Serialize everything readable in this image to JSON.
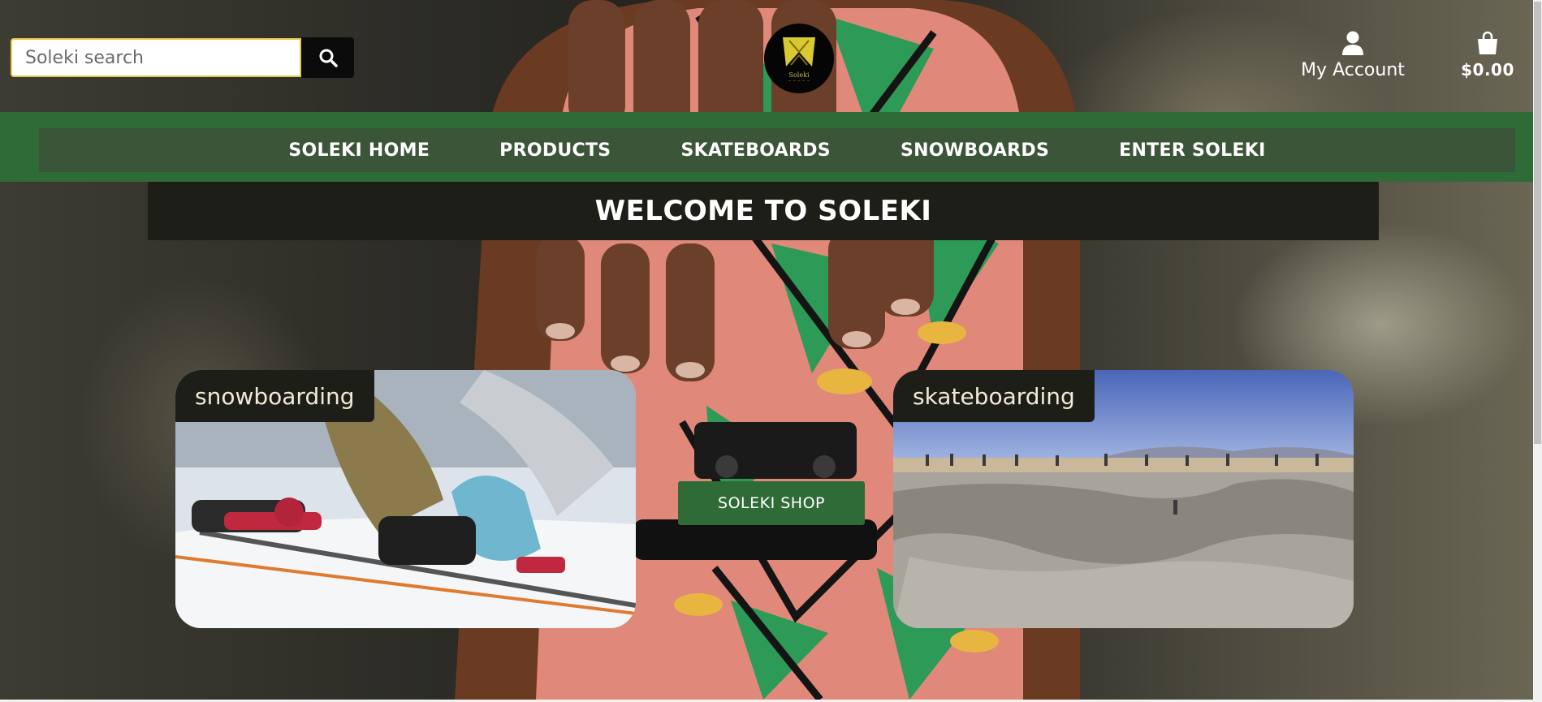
{
  "header": {
    "search": {
      "placeholder": "Soleki search",
      "value": ""
    },
    "logo": {
      "text": "Soleki"
    },
    "account": {
      "label": "My Account",
      "icon": "user-icon"
    },
    "cart": {
      "total": "$0.00",
      "icon": "shopping-bag-icon"
    }
  },
  "nav": {
    "items": [
      {
        "label": "SOLEKI HOME"
      },
      {
        "label": "PRODUCTS"
      },
      {
        "label": "SKATEBOARDS"
      },
      {
        "label": "SNOWBOARDS"
      },
      {
        "label": "ENTER SOLEKI"
      }
    ]
  },
  "main": {
    "welcome_title": "WELCOME TO SOLEKI",
    "cards": [
      {
        "label": "snowboarding"
      },
      {
        "label": "skateboarding"
      }
    ],
    "shop_button": "SOLEKI SHOP"
  },
  "colors": {
    "brand_green": "#2f6b36",
    "dark_panel": "#1e1e18",
    "search_border": "#e6c84a"
  }
}
